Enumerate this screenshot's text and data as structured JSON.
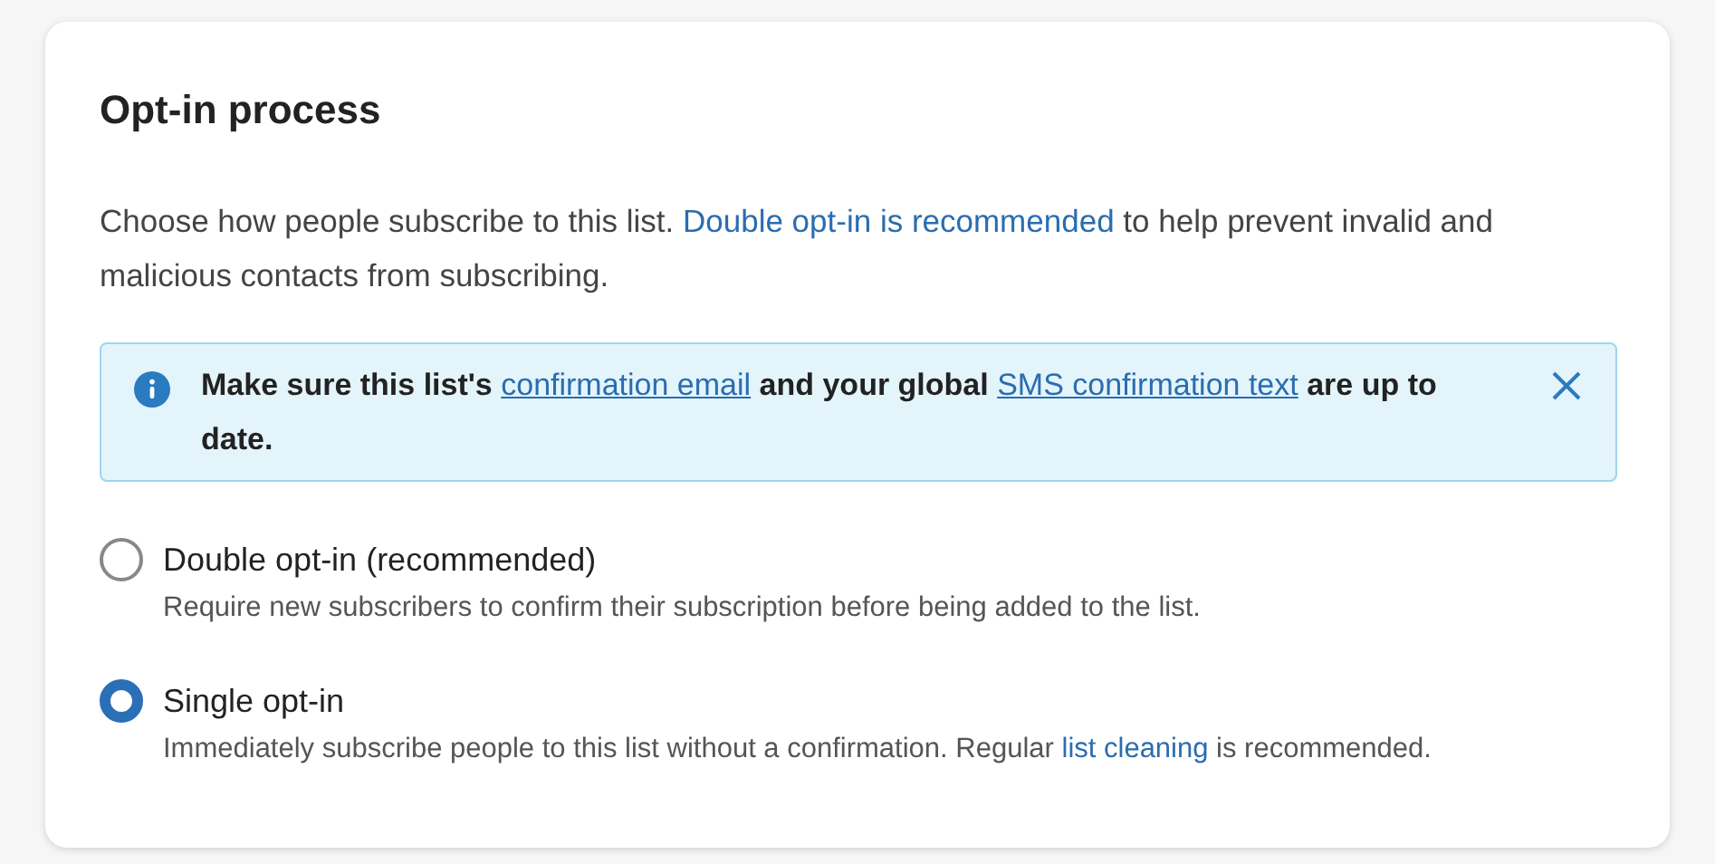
{
  "card": {
    "title": "Opt-in process",
    "description": [
      {
        "kind": "text",
        "text": "Choose how people subscribe to this list. "
      },
      {
        "kind": "link",
        "text": "Double opt-in is recommended"
      },
      {
        "kind": "text",
        "text": " to help prevent invalid and malicious contacts from subscribing."
      }
    ],
    "alert": {
      "dismissible": true,
      "parts": [
        {
          "kind": "text",
          "text": "Make sure this list's "
        },
        {
          "kind": "link",
          "text": "confirmation email"
        },
        {
          "kind": "text",
          "text": " and your global "
        },
        {
          "kind": "link",
          "text": "SMS confirmation text"
        },
        {
          "kind": "text",
          "text": " are up to date."
        }
      ]
    },
    "options": [
      {
        "label": "Double opt-in (recommended)",
        "selected": false,
        "description": [
          {
            "kind": "text",
            "text": "Require new subscribers to confirm their subscription before being added to the list."
          }
        ]
      },
      {
        "label": "Single opt-in",
        "selected": true,
        "description": [
          {
            "kind": "text",
            "text": "Immediately subscribe people to this list without a confirmation. Regular "
          },
          {
            "kind": "link",
            "text": "list cleaning"
          },
          {
            "kind": "text",
            "text": " is recommended."
          }
        ]
      }
    ]
  }
}
